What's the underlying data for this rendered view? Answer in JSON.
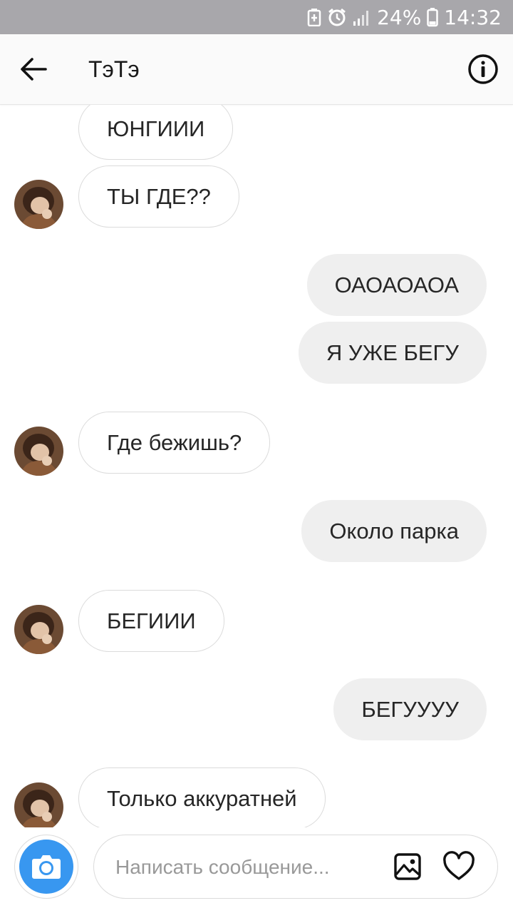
{
  "status_bar": {
    "battery_percent": "24%",
    "time": "14:32"
  },
  "header": {
    "title": "ТэТэ"
  },
  "messages": [
    {
      "side": "in",
      "text": "ЮНГИИИ"
    },
    {
      "side": "in",
      "text": "ТЫ ГДЕ??"
    },
    {
      "side": "out",
      "text": "ОАОАОАОА"
    },
    {
      "side": "out",
      "text": "Я УЖЕ БЕГУ"
    },
    {
      "side": "in",
      "text": "Где бежишь?"
    },
    {
      "side": "out",
      "text": "Около парка"
    },
    {
      "side": "in",
      "text": "БЕГИИИ"
    },
    {
      "side": "out",
      "text": "БЕГУУУУ"
    },
    {
      "side": "in",
      "text": "Только аккуратней"
    }
  ],
  "composer": {
    "placeholder": "Написать сообщение..."
  },
  "colors": {
    "status_bar": "#a8a7ab",
    "accent": "#3897f0",
    "outgoing_bubble": "#efefef",
    "incoming_border": "#dbdbdb"
  },
  "icons": {
    "back": "arrow-left-icon",
    "info": "info-icon",
    "camera": "camera-icon",
    "gallery": "image-icon",
    "like": "heart-icon"
  }
}
